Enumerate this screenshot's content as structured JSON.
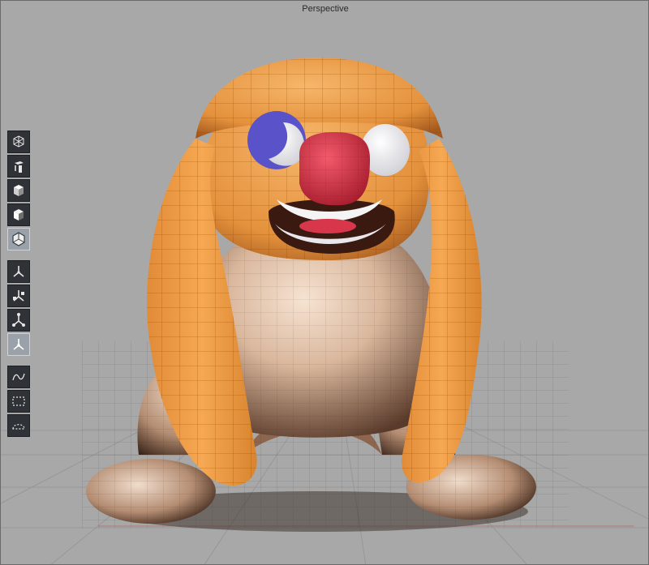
{
  "viewport": {
    "title": "Perspective"
  },
  "toolbar": {
    "groups": [
      {
        "name": "display-modes",
        "items": [
          {
            "icon": "wireframe-cube-icon",
            "active": false
          },
          {
            "icon": "points-cube-icon",
            "active": false
          },
          {
            "icon": "solid-cube-icon",
            "active": false
          },
          {
            "icon": "shaded-cube-icon",
            "active": false
          },
          {
            "icon": "hex-cube-icon",
            "active": true
          }
        ]
      },
      {
        "name": "manipulators",
        "items": [
          {
            "icon": "move-axis-icon",
            "active": false
          },
          {
            "icon": "rotate-axis-icon",
            "active": false
          },
          {
            "icon": "scale-axis-icon",
            "active": false
          },
          {
            "icon": "universal-axis-icon",
            "active": true
          }
        ]
      },
      {
        "name": "selection",
        "items": [
          {
            "icon": "lasso-select-icon",
            "active": false
          },
          {
            "icon": "rect-select-icon",
            "active": false
          },
          {
            "icon": "paint-select-icon",
            "active": false
          }
        ]
      }
    ]
  },
  "colors": {
    "background": "#a8a8a8",
    "body": "#d4b39a",
    "ears": "#f0a24a",
    "nose": "#d8364a",
    "eye_white": "#f4f4f4",
    "eye_blue": "#5a52c8",
    "grid": "#9a9a9a",
    "toolbar_button": "#2f3338"
  }
}
